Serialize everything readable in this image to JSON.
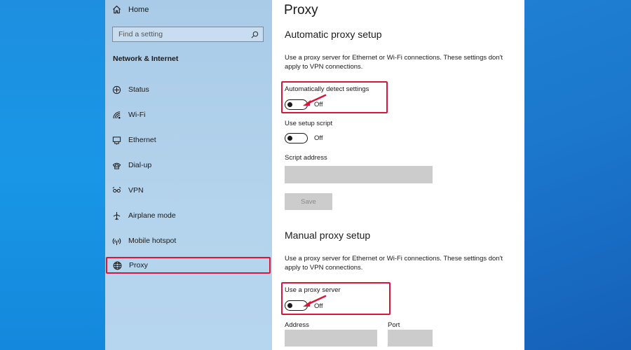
{
  "sidebar": {
    "home_label": "Home",
    "search_placeholder": "Find a setting",
    "section_title": "Network & Internet",
    "items": [
      {
        "label": "Status",
        "icon": "status-icon"
      },
      {
        "label": "Wi-Fi",
        "icon": "wifi-icon"
      },
      {
        "label": "Ethernet",
        "icon": "ethernet-icon"
      },
      {
        "label": "Dial-up",
        "icon": "dialup-icon"
      },
      {
        "label": "VPN",
        "icon": "vpn-icon"
      },
      {
        "label": "Airplane mode",
        "icon": "airplane-icon"
      },
      {
        "label": "Mobile hotspot",
        "icon": "hotspot-icon"
      },
      {
        "label": "Proxy",
        "icon": "globe-icon",
        "selected": true
      }
    ]
  },
  "main": {
    "title": "Proxy",
    "auto": {
      "heading": "Automatic proxy setup",
      "description": "Use a proxy server for Ethernet or Wi-Fi connections. These settings don't apply to VPN connections.",
      "detect_label": "Automatically detect settings",
      "detect_state": "Off",
      "script_label": "Use setup script",
      "script_state": "Off",
      "address_label": "Script address",
      "address_value": "",
      "save_label": "Save"
    },
    "manual": {
      "heading": "Manual proxy setup",
      "description": "Use a proxy server for Ethernet or Wi-Fi connections. These settings don't apply to VPN connections.",
      "proxy_label": "Use a proxy server",
      "proxy_state": "Off",
      "address_label": "Address",
      "port_label": "Port",
      "address_value": "",
      "port_value": ""
    }
  },
  "colors": {
    "highlight": "#d8173a",
    "accent": "#0078d7"
  }
}
